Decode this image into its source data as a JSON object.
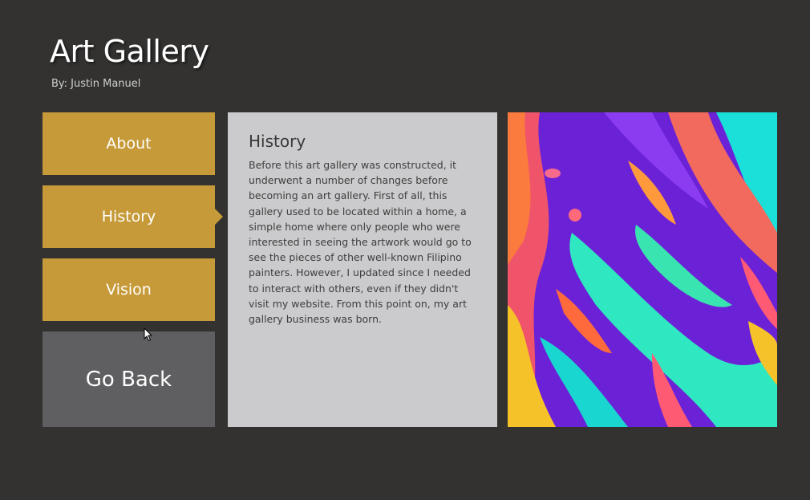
{
  "header": {
    "title": "Art Gallery",
    "byline": "By: Justin Manuel"
  },
  "nav": {
    "items": [
      {
        "label": "About",
        "active": false
      },
      {
        "label": "History",
        "active": true
      },
      {
        "label": "Vision",
        "active": false
      }
    ],
    "back_label": "Go Back"
  },
  "content": {
    "title": "History",
    "body": "Before this art gallery was constructed, it underwent a number of changes before becoming an art gallery. First of all, this gallery used to be located within a home, a simple home where only people who were interested in seeing the artwork would go to see the pieces of other well-known Filipino painters. However, I updated since I needed to interact with others, even if they didn't visit my website. From this point on, my art gallery business was born."
  },
  "colors": {
    "background": "#333231",
    "accent": "#c69a39",
    "back_button": "#5f5e60",
    "panel": "#cbcacc"
  }
}
